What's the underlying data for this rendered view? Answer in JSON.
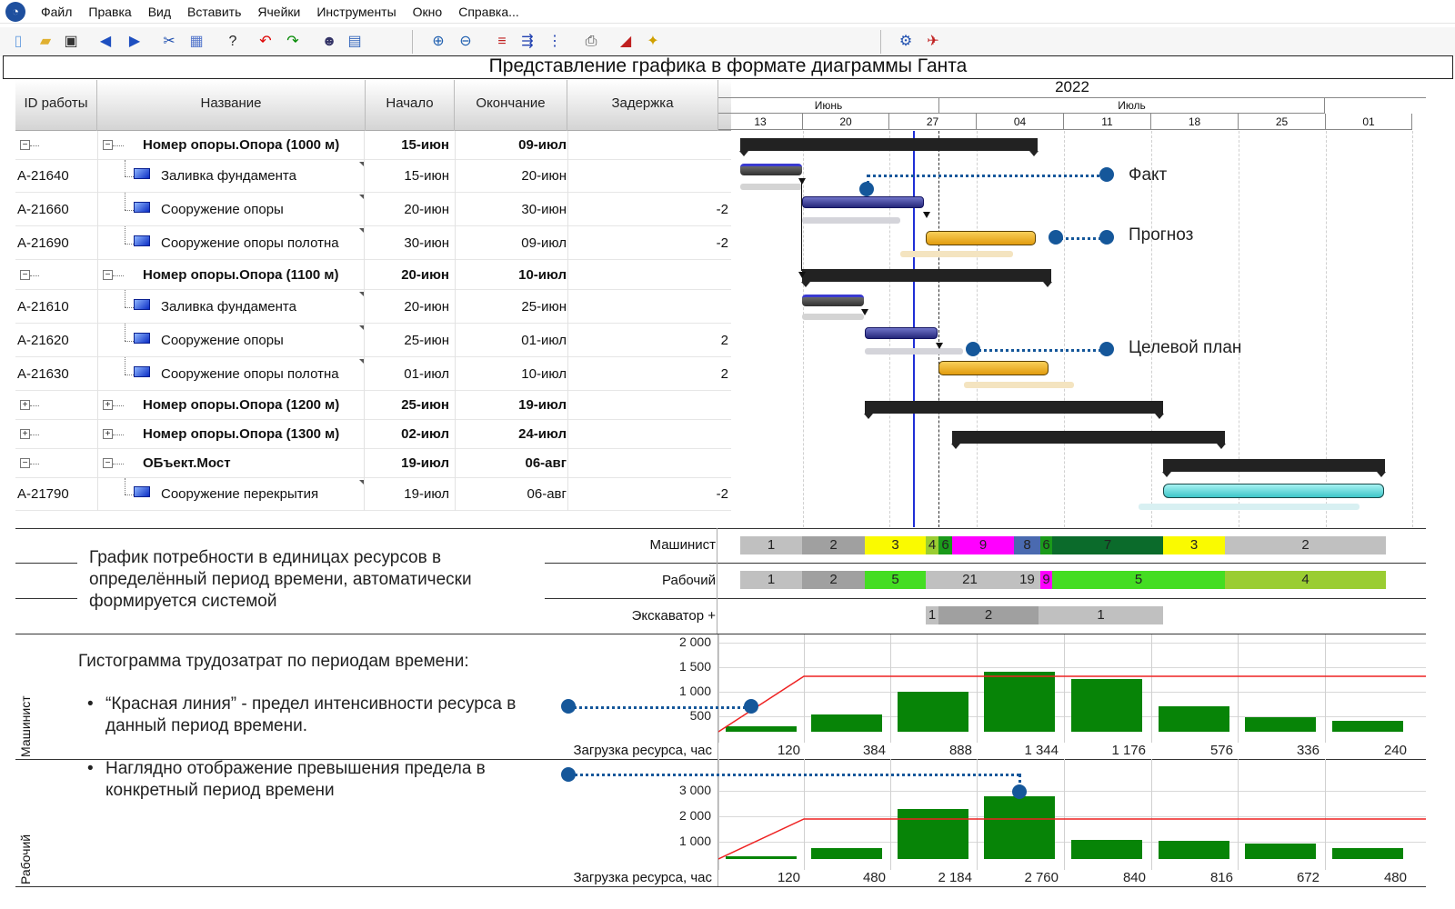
{
  "menu": [
    "Файл",
    "Правка",
    "Вид",
    "Вставить",
    "Ячейки",
    "Инструменты",
    "Окно",
    "Справка..."
  ],
  "toolbar": {
    "icons": [
      "new-file-icon",
      "open-folder-icon",
      "save-icon",
      "back-icon",
      "forward-icon",
      "tools-icon",
      "grid-icon",
      "help-icon",
      "undo-icon",
      "redo-icon",
      "user-icon",
      "table-icon",
      "zoom-in-icon",
      "zoom-out-icon",
      "gantt-link-icon",
      "gantt-indent-icon",
      "gantt-outdent-icon",
      "print-icon",
      "chart-icon",
      "highlight-icon",
      "settings-icon",
      "wand-icon"
    ]
  },
  "title": "Представление графика в формате диаграммы Ганта",
  "columns": {
    "id": "ID работы",
    "name": "Название",
    "start": "Начало",
    "end": "Окончание",
    "delay": "Задержка"
  },
  "rows": [
    {
      "id": "",
      "name": "Номер опоры.Опора (1000 м)",
      "start": "15-июн",
      "end": "09-июл",
      "delay": "",
      "summary": true,
      "expanded": true
    },
    {
      "id": "A-21640",
      "name": "Заливка фундамента",
      "start": "15-июн",
      "end": "20-июн",
      "delay": ""
    },
    {
      "id": "A-21660",
      "name": "Сооружение опоры",
      "start": "20-июн",
      "end": "30-июн",
      "delay": "-2"
    },
    {
      "id": "A-21690",
      "name": "Сооружение опоры полотна",
      "start": "30-июн",
      "end": "09-июл",
      "delay": "-2"
    },
    {
      "id": "",
      "name": "Номер опоры.Опора (1100 м)",
      "start": "20-июн",
      "end": "10-июл",
      "delay": "",
      "summary": true,
      "expanded": true
    },
    {
      "id": "A-21610",
      "name": "Заливка фундамента",
      "start": "20-июн",
      "end": "25-июн",
      "delay": ""
    },
    {
      "id": "A-21620",
      "name": "Сооружение опоры",
      "start": "25-июн",
      "end": "01-июл",
      "delay": "2"
    },
    {
      "id": "A-21630",
      "name": "Сооружение опоры полотна",
      "start": "01-июл",
      "end": "10-июл",
      "delay": "2"
    },
    {
      "id": "",
      "name": "Номер опоры.Опора (1200 м)",
      "start": "25-июн",
      "end": "19-июл",
      "delay": "",
      "summary": true,
      "expanded": false
    },
    {
      "id": "",
      "name": "Номер опоры.Опора (1300 м)",
      "start": "02-июл",
      "end": "24-июл",
      "delay": "",
      "summary": true,
      "expanded": false
    },
    {
      "id": "",
      "name": "ОБъект.Мост",
      "start": "19-июл",
      "end": "06-авг",
      "delay": "",
      "summary": true,
      "expanded": true
    },
    {
      "id": "A-21790",
      "name": "Сооружение перекрытия",
      "start": "19-июл",
      "end": "06-авг",
      "delay": "-2"
    }
  ],
  "timeline": {
    "year": "2022",
    "months": [
      "Июнь",
      "Июль"
    ],
    "weeks": [
      "13",
      "20",
      "27",
      "04",
      "11",
      "18",
      "25",
      "01"
    ]
  },
  "callouts": {
    "fact": "Факт",
    "forecast": "Прогноз",
    "target": "Целевой план"
  },
  "resources": {
    "labels": [
      "Машинист",
      "Рабочий",
      "Экскаватор +"
    ],
    "machinist": [
      "1",
      "2",
      "3",
      "4",
      "6",
      "9",
      "8",
      "6",
      "7",
      "3",
      "2"
    ],
    "worker": [
      "1",
      "2",
      "5",
      "21",
      "19",
      "9",
      "5",
      "4"
    ],
    "excavator": [
      "1",
      "2",
      "1"
    ]
  },
  "notes": {
    "resource_note": "График потребности в единицах ресурсов в определённый период времени, автоматически формируется системой",
    "histo_title": "Гистограмма трудозатрат по периодам времени:",
    "bullet1": "“Красная линия” - предел интенсивности ресурса в данный период времени.",
    "bullet2": "Наглядно отображение превышения предела в конкретный период времени"
  },
  "histograms": [
    {
      "resource": "Машинист",
      "axis_ticks": [
        "2 000",
        "1 500",
        "1 000",
        "500"
      ],
      "ylim": [
        0,
        2000
      ],
      "limit_label": "Загрузка ресурса, час",
      "values": [
        120,
        384,
        888,
        1344,
        1176,
        576,
        336,
        240
      ],
      "value_labels": [
        "120",
        "384",
        "888",
        "1 344",
        "1 176",
        "576",
        "336",
        "240"
      ]
    },
    {
      "resource": "Рабочий",
      "axis_ticks": [
        "3 000",
        "2 000",
        "1 000"
      ],
      "ylim": [
        0,
        3200
      ],
      "limit_label": "Загрузка ресурса, час",
      "values": [
        120,
        480,
        2184,
        2760,
        840,
        816,
        672,
        480
      ],
      "value_labels": [
        "120",
        "480",
        "2 184",
        "2 760",
        "840",
        "816",
        "672",
        "480"
      ]
    }
  ],
  "colors": {
    "accent": "#15579a",
    "histogram": "#078407",
    "today_line": "#1f2fd6",
    "redline": "#ee2222"
  }
}
